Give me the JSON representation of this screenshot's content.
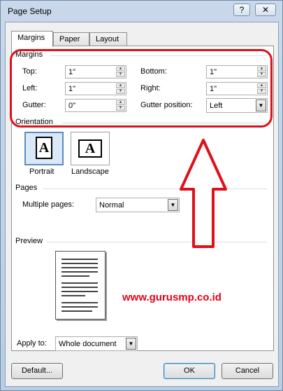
{
  "window": {
    "title": "Page Setup",
    "help_label": "?",
    "close_label": "✕"
  },
  "tabs": [
    {
      "label": "Margins",
      "active": true
    },
    {
      "label": "Paper",
      "active": false
    },
    {
      "label": "Layout",
      "active": false
    }
  ],
  "margins": {
    "section_label": "Margins",
    "top_label": "Top:",
    "top_value": "1\"",
    "bottom_label": "Bottom:",
    "bottom_value": "1\"",
    "left_label": "Left:",
    "left_value": "1\"",
    "right_label": "Right:",
    "right_value": "1\"",
    "gutter_label": "Gutter:",
    "gutter_value": "0\"",
    "gutter_position_label": "Gutter position:",
    "gutter_position_value": "Left"
  },
  "orientation": {
    "section_label": "Orientation",
    "portrait_label": "Portrait",
    "landscape_label": "Landscape",
    "glyph": "A",
    "selected": "Portrait"
  },
  "pages": {
    "section_label": "Pages",
    "multiple_pages_label": "Multiple pages:",
    "multiple_pages_value": "Normal"
  },
  "preview": {
    "section_label": "Preview",
    "apply_to_label": "Apply to:",
    "apply_to_value": "Whole document"
  },
  "watermark": {
    "text": "www.gurusmp.co.id",
    "color": "#e60012"
  },
  "buttons": {
    "default_label": "Default...",
    "ok_label": "OK",
    "cancel_label": "Cancel"
  },
  "annotation_color": "#e0101a"
}
